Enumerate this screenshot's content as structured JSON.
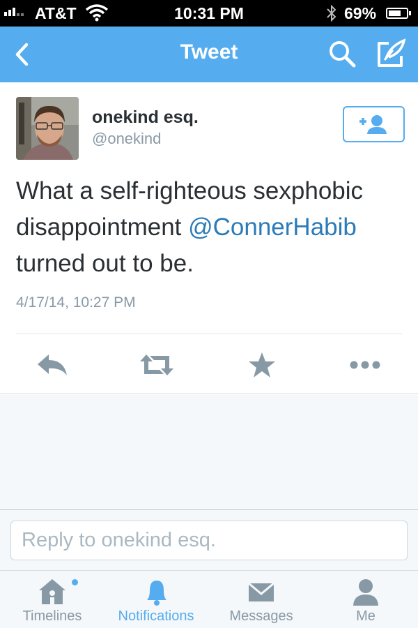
{
  "status_bar": {
    "carrier": "AT&T",
    "time": "10:31 PM",
    "battery_percent": "69%",
    "battery_level": 0.69
  },
  "nav": {
    "title": "Tweet",
    "icons": [
      "back-chevron-icon",
      "search-icon",
      "compose-icon"
    ]
  },
  "tweet": {
    "user_name": "onekind esq.",
    "user_handle": "@onekind",
    "text_before": "What a self-righteous sexphobic disappointment ",
    "mention": "@ConnerHabib",
    "text_after": " turned out to be.",
    "timestamp": "4/17/14, 10:27 PM",
    "actions": [
      "reply-icon",
      "retweet-icon",
      "favorite-icon",
      "more-icon"
    ]
  },
  "reply": {
    "placeholder": "Reply to onekind esq."
  },
  "tabs": [
    {
      "label": "Timelines",
      "icon": "home-icon"
    },
    {
      "label": "Notifications",
      "icon": "bell-icon"
    },
    {
      "label": "Messages",
      "icon": "envelope-icon"
    },
    {
      "label": "Me",
      "icon": "person-icon"
    }
  ],
  "colors": {
    "accent": "#55acee",
    "mention": "#2b7bb9",
    "icon_gray": "#8899a6"
  }
}
